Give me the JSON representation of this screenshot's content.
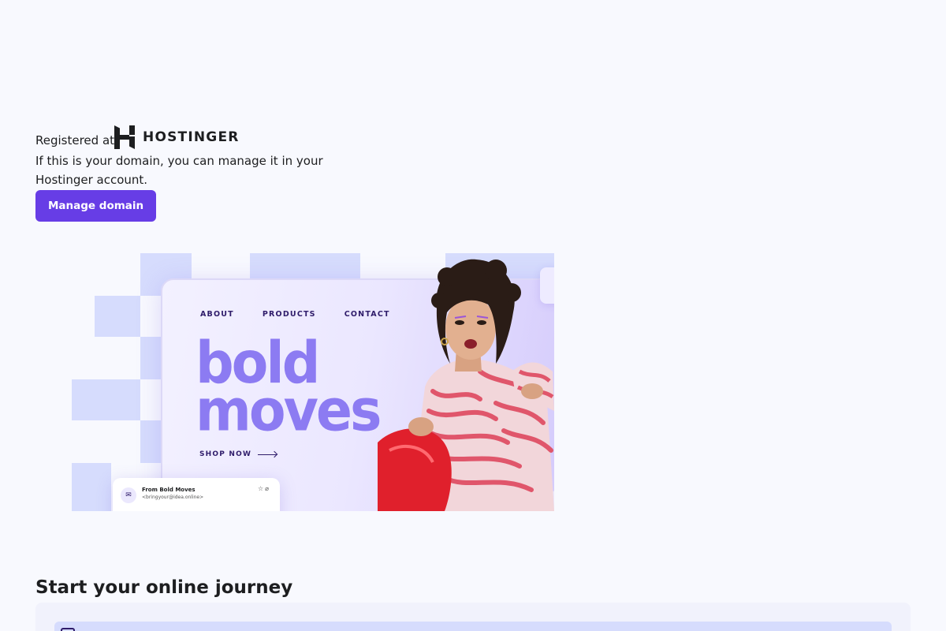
{
  "registration": {
    "prefix": "Registered at",
    "brand": "HOSTINGER",
    "description": "If this is your domain, you can manage it in your Hostinger account.",
    "button_label": "Manage domain"
  },
  "hero": {
    "nav": [
      "ABOUT",
      "PRODUCTS",
      "CONTACT"
    ],
    "headline_line1": "bold",
    "headline_line2": "moves",
    "cta": "SHOP NOW",
    "email_from": "From Bold Moves",
    "email_address": "<bringyour@idea.online>"
  },
  "journey": {
    "title": "Start your online journey"
  },
  "colors": {
    "accent": "#673de6",
    "background": "#f8f9fe",
    "hero_squares": "#d6dcfd",
    "headline": "#8c7bf2"
  },
  "icons": [
    "hostinger-logo-icon",
    "mail-icon",
    "star-icon",
    "paperclip-icon",
    "arrow-right-icon",
    "journey-item-icon"
  ]
}
